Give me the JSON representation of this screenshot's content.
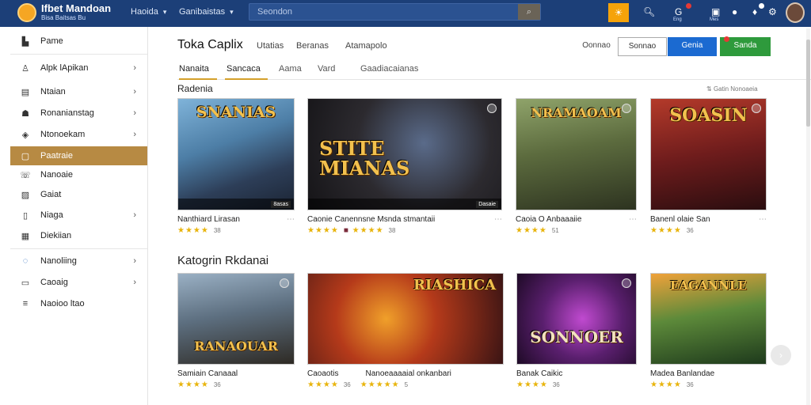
{
  "app": {
    "brand_title": "Ifbet Mandoan",
    "brand_subtitle": "Bisa Baitsas Bu",
    "logo_icon": "shield-logo"
  },
  "topnav": {
    "items": [
      {
        "label": "Haoida"
      },
      {
        "label": "Ganibaistas"
      }
    ],
    "search_placeholder": "Seondon",
    "search_icon": "search-icon"
  },
  "topicons": [
    {
      "name": "star-icon"
    },
    {
      "name": "search-icon"
    },
    {
      "name": "globe-icon",
      "label": "Eng"
    },
    {
      "name": "chat-icon",
      "label": "Mes"
    },
    {
      "name": "bubble-icon"
    },
    {
      "name": "bell-icon"
    }
  ],
  "sidebar": {
    "items": [
      {
        "label": "Pame",
        "icon": "home-icon",
        "chevron": false
      },
      {
        "label": "Alpk lApikan",
        "icon": "person-icon",
        "chevron": true
      },
      {
        "label": "Ntaian",
        "icon": "grid-icon",
        "chevron": true
      },
      {
        "label": "Ronanianstag",
        "icon": "user-icon",
        "chevron": true
      },
      {
        "label": "Ntonoekam",
        "icon": "tag-icon",
        "chevron": true
      },
      {
        "label": "Paatraie",
        "icon": "folder-icon",
        "chevron": false,
        "active": true
      },
      {
        "label": "Nanoaie",
        "icon": "phone-icon",
        "chevron": false
      },
      {
        "label": "Gaiat",
        "icon": "image-icon",
        "chevron": false
      },
      {
        "label": "Niaga",
        "icon": "doc-icon",
        "chevron": true
      },
      {
        "label": "Diekiian",
        "icon": "list-icon",
        "chevron": false
      },
      {
        "label": "Nanoliing",
        "icon": "search-icon",
        "chevron": true
      },
      {
        "label": "Caoaig",
        "icon": "box-icon",
        "chevron": true
      },
      {
        "label": "Naoioo ltao",
        "icon": "menu-icon",
        "chevron": false
      }
    ]
  },
  "header": {
    "title": "Toka Caplix",
    "tabs": [
      "Utatias",
      "Beranas",
      "Atamapolo"
    ],
    "buttons": {
      "b1": "Oonnao",
      "b2": "Sonnao",
      "b3": "Genia",
      "b4": "Sanda"
    }
  },
  "tabs": [
    "Nanaita",
    "Sancaca",
    "Aama",
    "Vard",
    "Gaadiacaianas"
  ],
  "section1": {
    "title": "Radenia",
    "meta": "Gatin Nonoaeia"
  },
  "section2": {
    "title": "Katogrin Rkdanai"
  },
  "games1": [
    {
      "art": "SNANIAS",
      "name": "Nanthiard Lirasan",
      "rating": "38",
      "tag": "8asas"
    },
    {
      "art": "STITE MIANAS",
      "name": "Caonie Canennsne Msnda stmantaii",
      "rating": "38",
      "tag": "Dasaie"
    },
    {
      "art": "NRAMAOAM",
      "name": "Caoia O Anbaaaiie",
      "rating": "51",
      "tag": ""
    },
    {
      "art": "SOASIN",
      "name": "Banenl olaie San",
      "rating": "36",
      "tag": ""
    }
  ],
  "games2": [
    {
      "art": "RANAOUAR",
      "name": "Samiain Canaaal",
      "rating": "36"
    },
    {
      "art": "RIASHICA",
      "name": "Caoaotis",
      "name2": "Nanoeaaaaial onkanbari",
      "rating": "36",
      "rating2": "5"
    },
    {
      "art": "SONNOER",
      "name": "Banak Caikic",
      "rating": "36"
    },
    {
      "art": "EAGANNLE",
      "name": "Madea Banlandae",
      "rating": "36"
    }
  ],
  "colors": {
    "topbar": "#1c3f78",
    "sidebar_active": "#b78a43",
    "star": "#e8b40c",
    "accent_green": "#2e9a3c",
    "accent_blue": "#1b6ad1"
  }
}
